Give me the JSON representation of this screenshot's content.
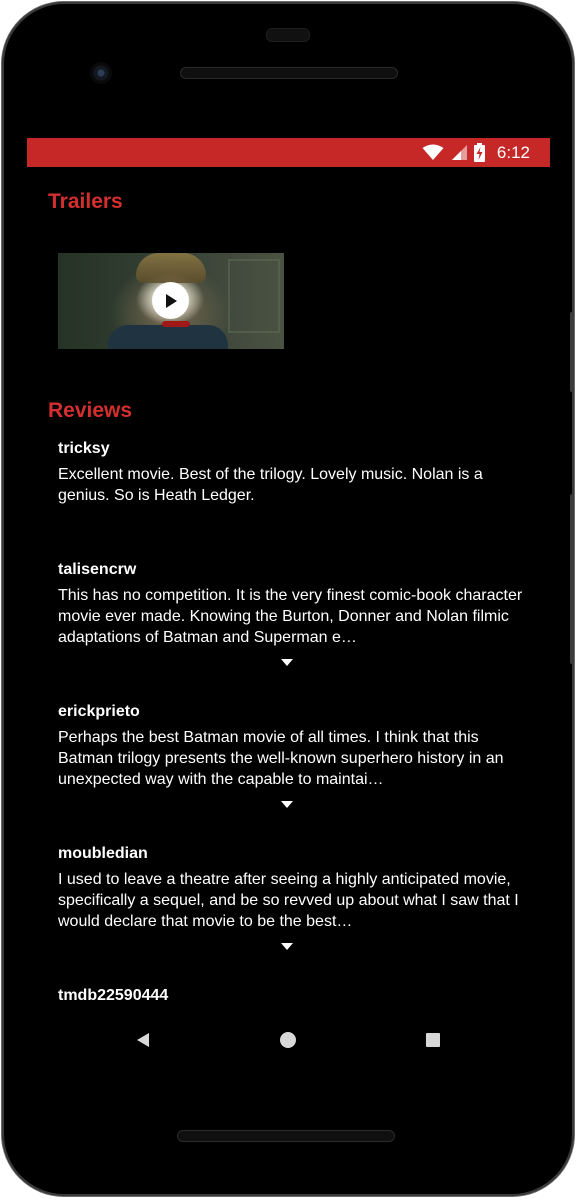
{
  "status_bar": {
    "time": "6:12",
    "icons": [
      "wifi-icon",
      "cell-signal-icon",
      "battery-charging-icon"
    ],
    "color": "#c62828"
  },
  "trailers": {
    "title": "Trailers",
    "items": [
      {
        "thumbnail_icon": "play-icon"
      }
    ]
  },
  "reviews": {
    "title": "Reviews",
    "items": [
      {
        "author": "tricksy",
        "content": "Excellent movie. Best of the trilogy. Lovely music. Nolan is a genius. So is Heath Ledger."
      },
      {
        "author": "talisencrw",
        "content": "This has no competition. It is the very finest comic-book character movie ever made. Knowing the Burton, Donner and Nolan filmic adaptations of Batman and Superman e…"
      },
      {
        "author": "erickprieto",
        "content": "Perhaps the best Batman movie of all times. I think that this Batman trilogy presents the well-known superhero history in an unexpected way with the capable to maintai…"
      },
      {
        "author": "moubledian",
        "content": "I used to leave a theatre after seeing a highly anticipated movie, specifically a sequel, and be so revved up about what I saw that I would declare that movie to be the best…"
      },
      {
        "author": "tmdb22590444",
        "content": ""
      }
    ]
  },
  "nav": {
    "icons": [
      "back-icon",
      "home-icon",
      "recents-icon"
    ]
  },
  "colors": {
    "accent": "#d32f2f",
    "background": "#000000",
    "text": "#ffffff"
  }
}
